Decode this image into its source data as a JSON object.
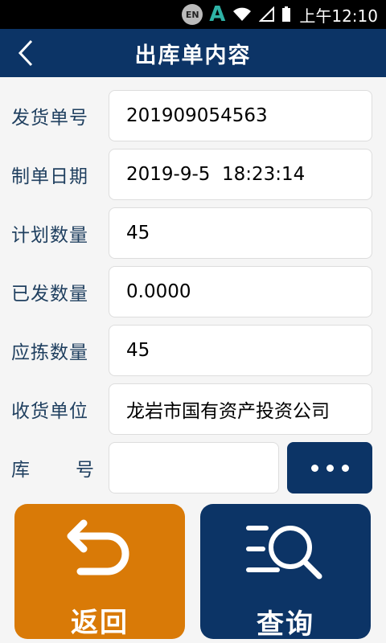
{
  "statusbar": {
    "ime": "EN",
    "input_app": "A",
    "time": "上午12:10"
  },
  "header": {
    "title": "出库单内容"
  },
  "form": {
    "rows": [
      {
        "label": "发货单号",
        "value": "201909054563"
      },
      {
        "label": "制单日期",
        "value": "2019-9-5  18:23:14"
      },
      {
        "label": "计划数量",
        "value": "45"
      },
      {
        "label": "已发数量",
        "value": "0.0000"
      },
      {
        "label": "应拣数量",
        "value": "45"
      },
      {
        "label": "收货单位",
        "value": "龙岩市国有资产投资公司"
      }
    ],
    "warehouse": {
      "label_left": "库",
      "label_right": "号",
      "value": ""
    }
  },
  "actions": {
    "back_label": "返回",
    "query_label": "查询"
  },
  "colors": {
    "primary": "#0c3466",
    "back_button": "#d97a07"
  }
}
